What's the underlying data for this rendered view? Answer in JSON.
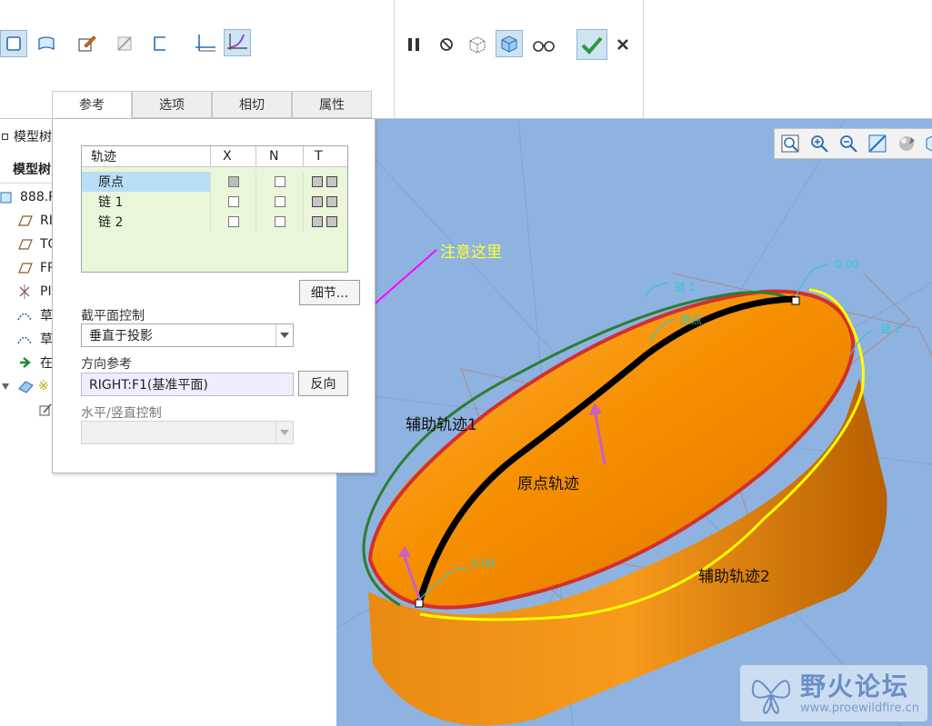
{
  "ribbon": {
    "icons": [
      "solid-icon",
      "surface-icon",
      "sketch-icon",
      "remove-material-icon",
      "thicken-icon",
      "constant-section-icon",
      "variable-section-icon"
    ],
    "right_icons": [
      "pause-icon",
      "no-preview-icon",
      "wireframe-preview-icon",
      "feature-preview-icon",
      "glasses-preview-icon"
    ],
    "confirm_icon": "checkmark-icon",
    "cancel_icon": "close-icon"
  },
  "tabs": [
    {
      "label": "参考",
      "active": true
    },
    {
      "label": "选项",
      "active": false
    },
    {
      "label": "相切",
      "active": false
    },
    {
      "label": "属性",
      "active": false
    }
  ],
  "tree": {
    "header_top": "模型树",
    "header": "模型树",
    "items": [
      {
        "icon": "part-icon",
        "label": "888.P"
      },
      {
        "icon": "datum-plane-icon",
        "label": "RI"
      },
      {
        "icon": "datum-plane-icon",
        "label": "TO"
      },
      {
        "icon": "datum-plane-icon",
        "label": "FR"
      },
      {
        "icon": "coordinate-system-icon",
        "label": "PI"
      },
      {
        "icon": "sketch-feature-icon",
        "label": "草"
      },
      {
        "icon": "sketch-feature-icon",
        "label": "草"
      },
      {
        "icon": "insert-here-icon",
        "label": "在"
      },
      {
        "icon": "sweep-feature-icon",
        "label": "※"
      }
    ]
  },
  "panel": {
    "table_headers": [
      "轨迹",
      "X",
      "N",
      "T"
    ],
    "rows": [
      {
        "name": "原点",
        "x": true,
        "n": false,
        "selected": true
      },
      {
        "name": "链 1",
        "x": false,
        "n": false,
        "selected": false
      },
      {
        "name": "链 2",
        "x": false,
        "n": false,
        "selected": false
      }
    ],
    "details_button": "细节...",
    "section_control_label": "截平面控制",
    "section_control_value": "垂直于投影",
    "direction_ref_label": "方向参考",
    "direction_ref_value": "RIGHT:F1(基准平面)",
    "flip_button": "反向",
    "hv_control_label": "水平/竖直控制",
    "hv_control_value": ""
  },
  "view_toolbar": {
    "icons": [
      "refit-icon",
      "zoom-in-icon",
      "zoom-out-icon",
      "repaint-icon",
      "display-style-icon",
      "saved-views-icon"
    ]
  },
  "viewport": {
    "annotations": {
      "note": "注意这里",
      "aux_traj_1": "辅助轨迹1",
      "origin_traj": "原点轨迹",
      "aux_traj_2": "辅助轨迹2"
    },
    "dimension_labels": [
      "0.00",
      "0.00"
    ],
    "chain_labels": [
      "链 1",
      "原点",
      "链 2"
    ]
  },
  "watermark": {
    "site_name": "野火论坛",
    "url": "www.proewildfire.cn"
  },
  "colors": {
    "viewport_bg": "#8eb3e0",
    "model_orange": "#f48a00",
    "origin_trajectory": "#000000",
    "aux_trajectory_1": "#2e7d32",
    "aux_trajectory_2": "#ffff00",
    "edge_red": "#d32f2f",
    "note_arrow": "#ff00ff",
    "note_text": "#ffff33",
    "selected_row": "#b9dff7",
    "grid_bg": "#e9f6d9"
  }
}
